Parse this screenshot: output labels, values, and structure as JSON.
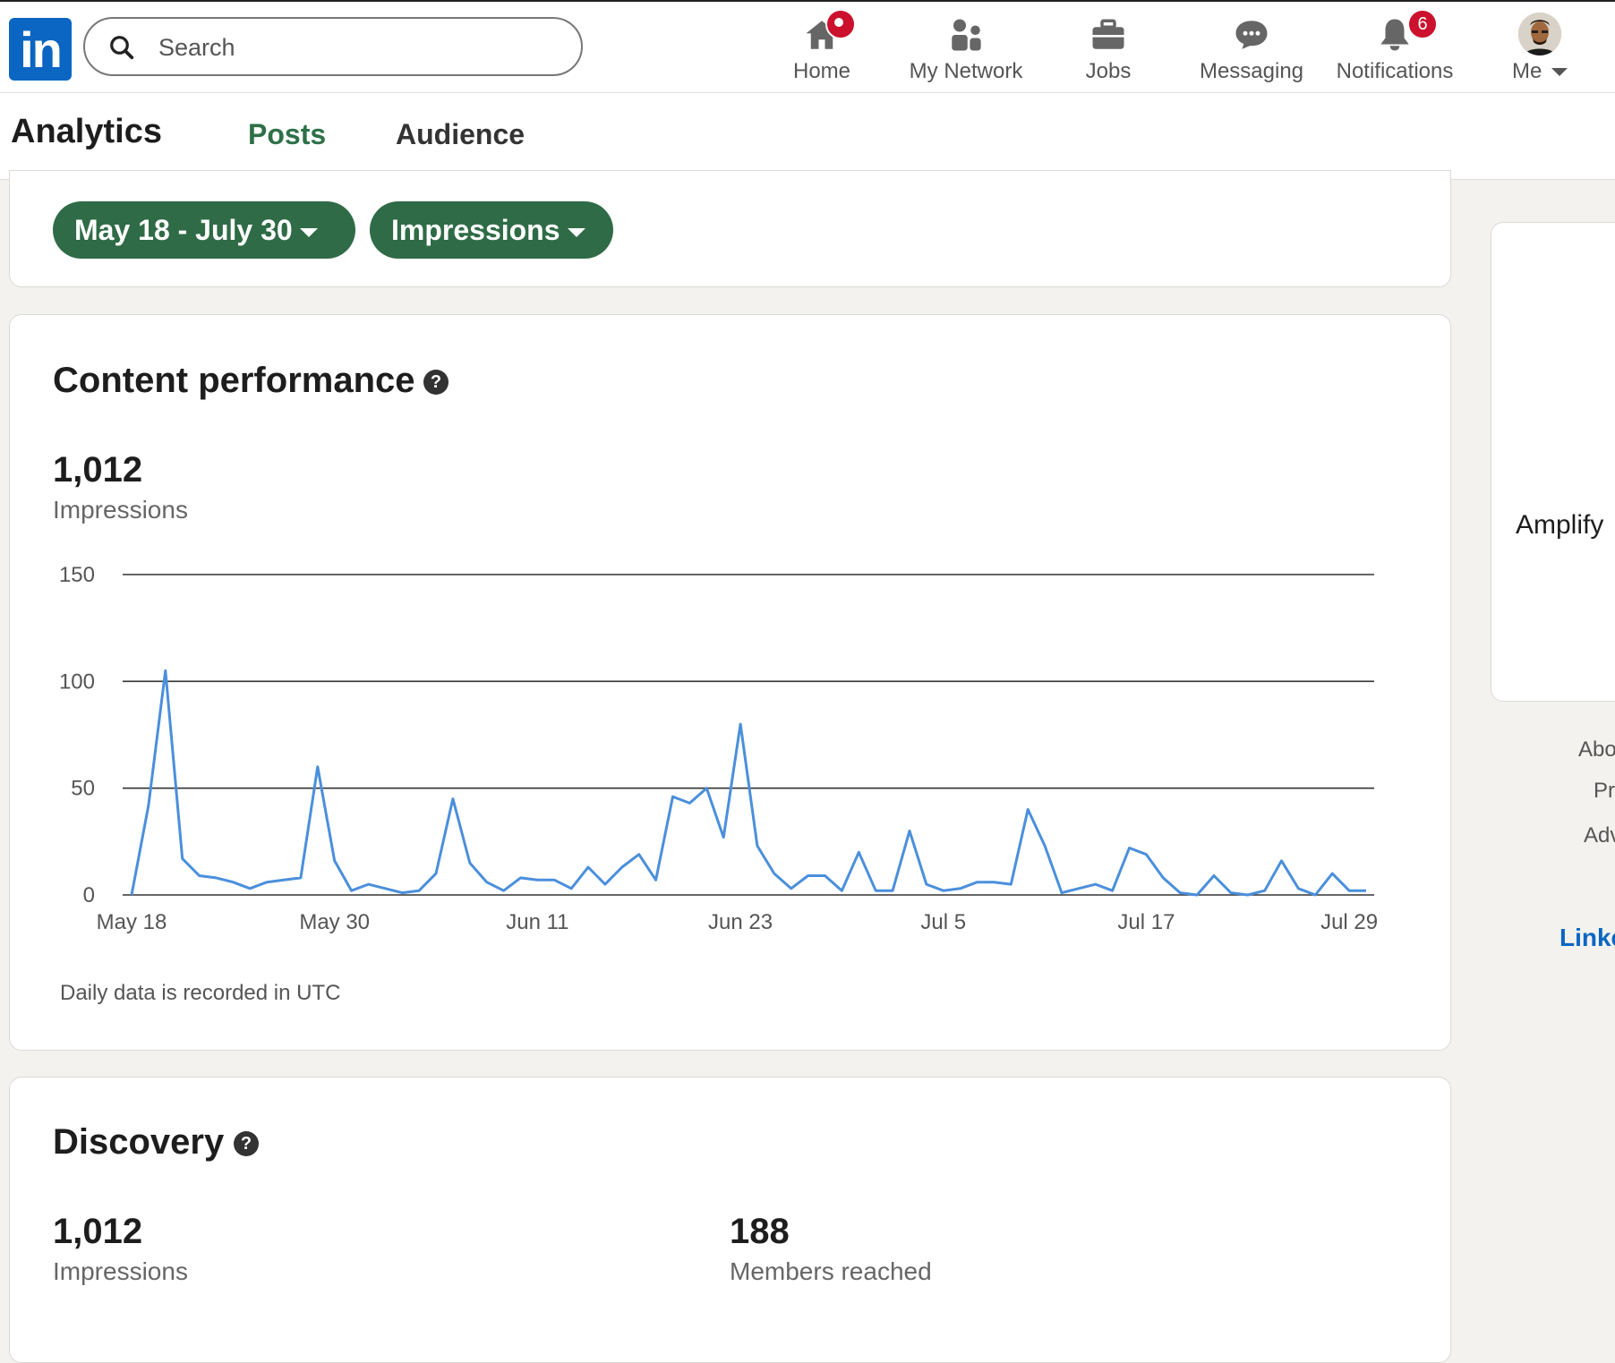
{
  "nav": {
    "logo": "in",
    "search_placeholder": "Search",
    "items": [
      {
        "label": "Home",
        "icon": "home-icon"
      },
      {
        "label": "My Network",
        "icon": "network-icon"
      },
      {
        "label": "Jobs",
        "icon": "briefcase-icon"
      },
      {
        "label": "Messaging",
        "icon": "messaging-icon"
      },
      {
        "label": "Notifications",
        "icon": "bell-icon",
        "badge": "6"
      },
      {
        "label": "Me",
        "icon": "avatar"
      }
    ]
  },
  "subnav": {
    "title": "Analytics",
    "tabs": [
      {
        "label": "Posts",
        "active": true
      },
      {
        "label": "Audience",
        "active": false
      }
    ]
  },
  "filters": {
    "date_range": "May 18 - July 30",
    "metric": "Impressions"
  },
  "content_performance": {
    "title": "Content performance",
    "total_value": "1,012",
    "total_label": "Impressions",
    "note": "Daily data is recorded in UTC"
  },
  "discovery": {
    "title": "Discovery",
    "impressions_value": "1,012",
    "impressions_label": "Impressions",
    "members_value": "188",
    "members_label": "Members reached"
  },
  "sidebar": {
    "amplify": "Amplify",
    "links": [
      "Abo",
      "Pr",
      "Adv"
    ],
    "brand": "Linke"
  },
  "colors": {
    "accent_green": "#2f6b46",
    "line_blue": "#4a8fdc",
    "brand_blue": "#0a66c2",
    "badge_red": "#cb112d"
  },
  "chart_data": {
    "type": "line",
    "ylim": [
      0,
      150
    ],
    "yticks": [
      0,
      50,
      100,
      150
    ],
    "xtick_labels": [
      "May 18",
      "May 30",
      "Jun 11",
      "Jun 23",
      "Jul 5",
      "Jul 17",
      "Jul 29"
    ],
    "series": [
      {
        "values": [
          0,
          42,
          105,
          17,
          9,
          8,
          6,
          3,
          6,
          7,
          8,
          60,
          16,
          2,
          5,
          3,
          1,
          2,
          10,
          45,
          15,
          6,
          2,
          8,
          7,
          7,
          3,
          13,
          5,
          13,
          19,
          7,
          46,
          43,
          50,
          27,
          80,
          23,
          10,
          3,
          9,
          9,
          2,
          20,
          2,
          2,
          30,
          5,
          2,
          3,
          6,
          6,
          5,
          40,
          23,
          1,
          3,
          5,
          2,
          22,
          19,
          8,
          1,
          0,
          9,
          1,
          0,
          2,
          16,
          3,
          0,
          10,
          2,
          2
        ]
      }
    ],
    "grid": true
  }
}
